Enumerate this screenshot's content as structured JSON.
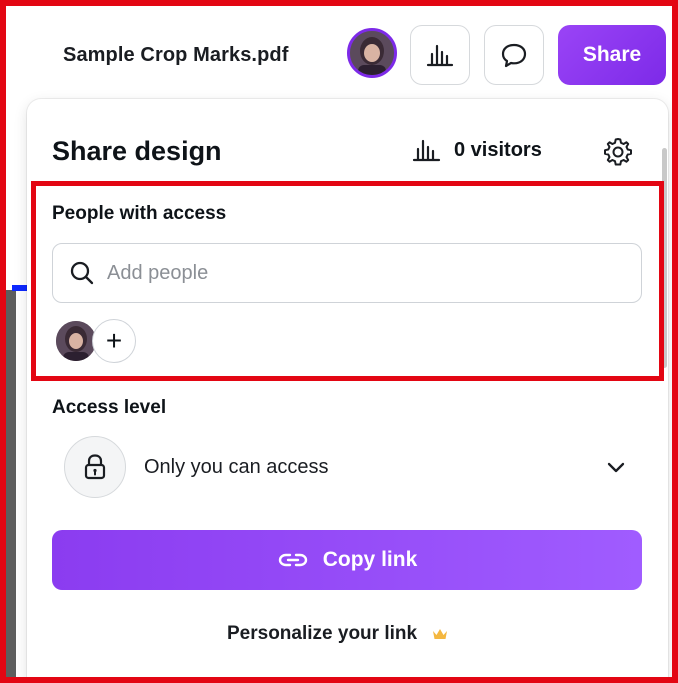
{
  "header": {
    "document_title": "Sample Crop Marks.pdf",
    "share_label": "Share",
    "icons": [
      "avatar",
      "insights-icon",
      "comment-icon"
    ]
  },
  "panel": {
    "title": "Share design",
    "visitors_label": "0 visitors",
    "people_section": {
      "label": "People with access",
      "search_placeholder": "Add people",
      "add_symbol": "+"
    },
    "access_section": {
      "label": "Access level",
      "selected": "Only you can access"
    },
    "copy_link_label": "Copy link",
    "personalize_label": "Personalize your link"
  },
  "colors": {
    "accent": "#7d2ae8",
    "highlight": "#e30613",
    "crown": "#f4b740"
  }
}
